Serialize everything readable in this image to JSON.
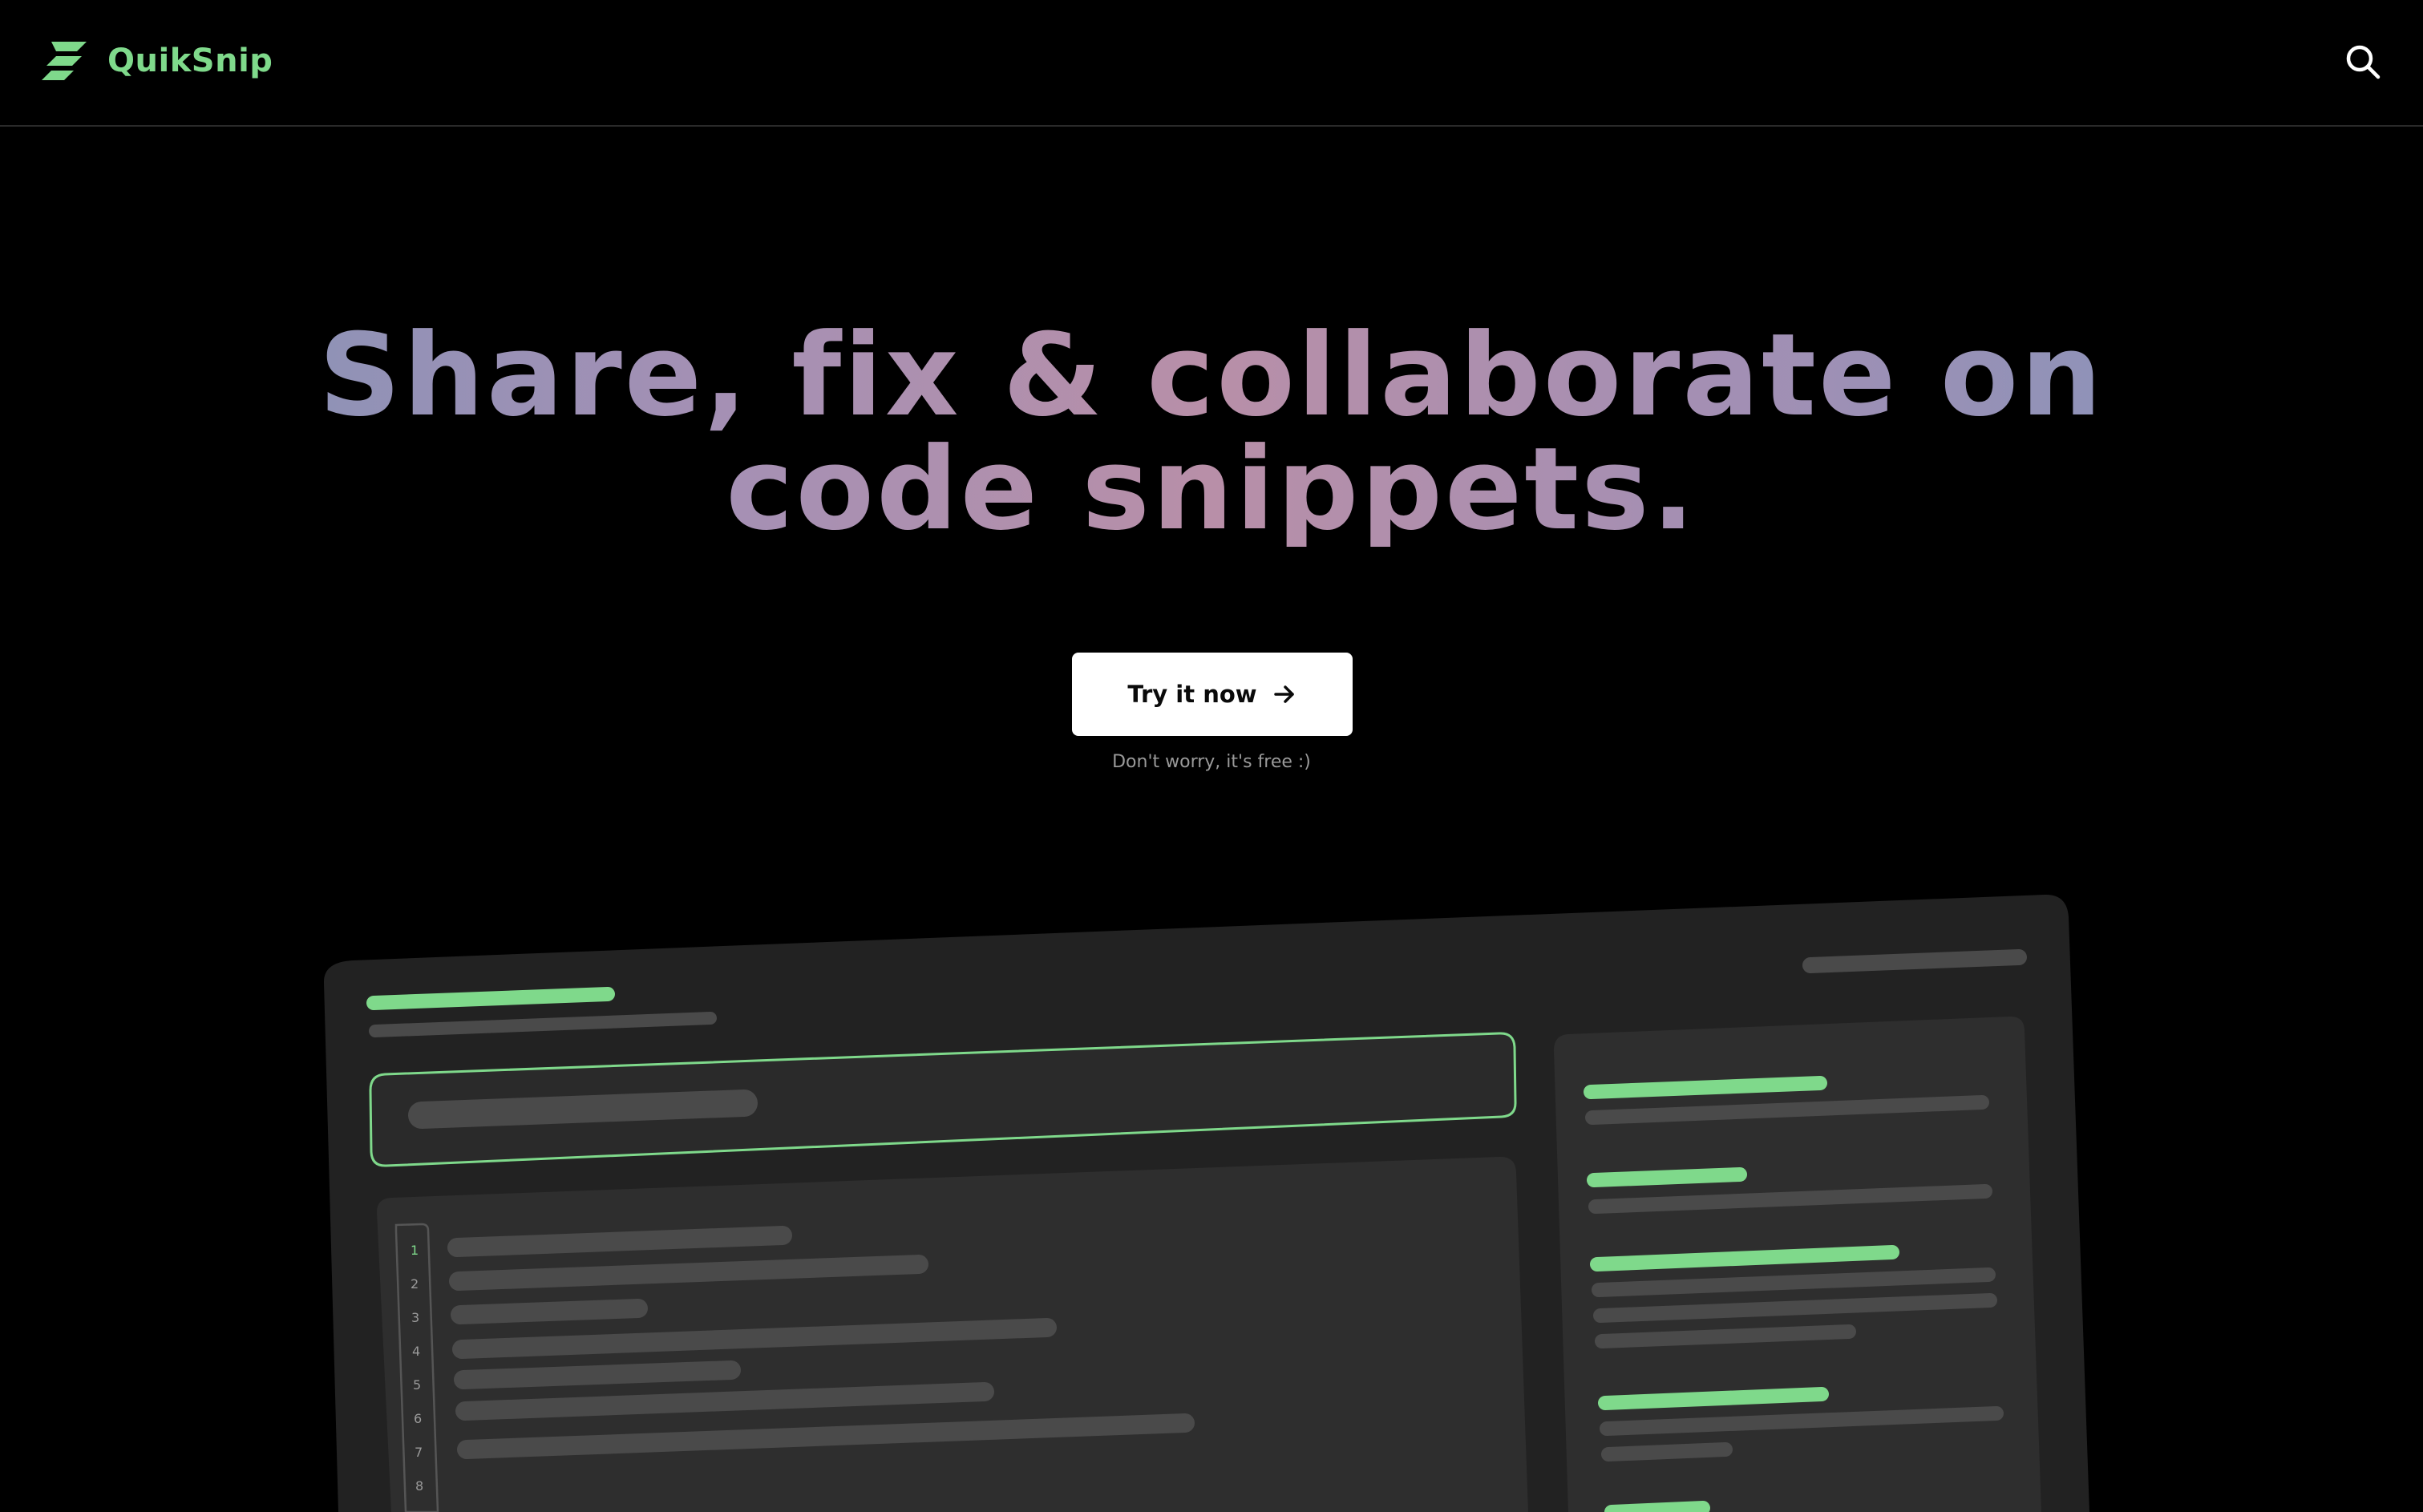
{
  "brand": {
    "name": "QuikSnip",
    "logo_icon": "lightning-bolt-logo"
  },
  "header": {
    "search_icon": "search-icon"
  },
  "hero": {
    "title_line1": "Share, fix & collaborate on",
    "title_line2": "code snippets.",
    "cta_label": "Try it now",
    "cta_icon": "arrow-right-icon",
    "cta_note": "Don't worry, it's free :)"
  },
  "mockup": {
    "line_numbers": [
      "1",
      "2",
      "3",
      "4",
      "5",
      "6",
      "7",
      "8"
    ]
  },
  "colors": {
    "background": "#000000",
    "accent_green": "#7fd98b",
    "card": "#222222",
    "panel": "#2e2e2e",
    "placeholder_bar": "#4a4a4a",
    "cta_bg": "#ffffff"
  }
}
